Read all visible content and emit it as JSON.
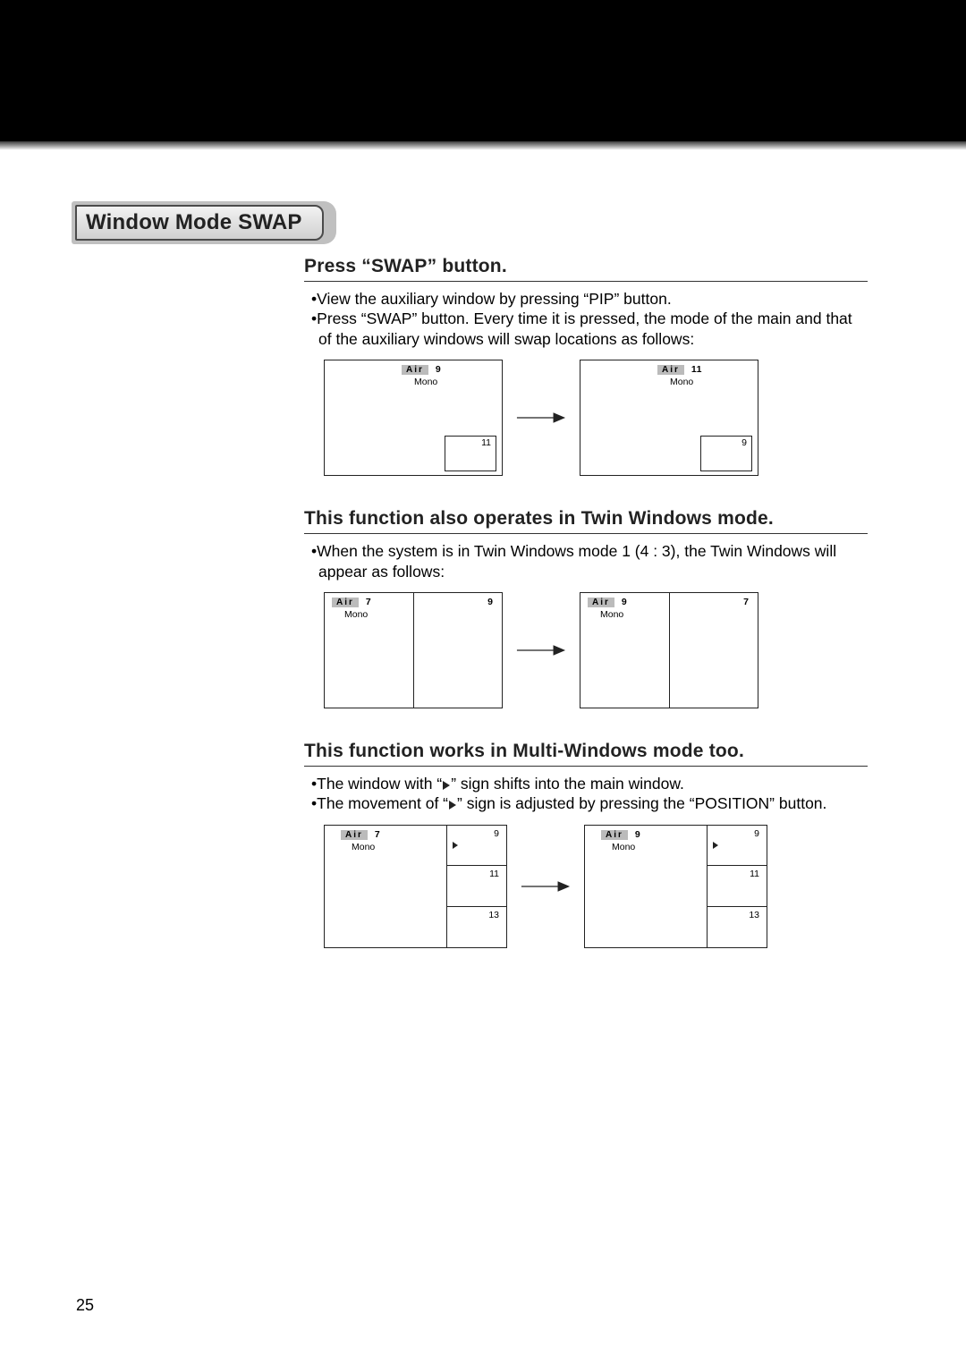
{
  "title": "Window Mode SWAP",
  "page_number": "25",
  "section1": {
    "heading": "Press “SWAP” button.",
    "bullets": [
      "View the auxiliary window by pressing “PIP” button.",
      "Press “SWAP” button. Every time it is pressed, the mode of the main and that of the auxiliary windows will swap locations as follows:"
    ],
    "left": {
      "air_label": "Air",
      "air_num": "9",
      "mono": "Mono",
      "pip_num": "11"
    },
    "right": {
      "air_label": "Air",
      "air_num": "11",
      "mono": "Mono",
      "pip_num": "9"
    }
  },
  "section2": {
    "heading": "This function also operates in Twin Windows mode.",
    "bullets": [
      "When the system is in Twin Windows mode 1 (4 : 3), the Twin Windows will appear as follows:"
    ],
    "left": {
      "air_label": "Air",
      "air_num": "7",
      "mono": "Mono",
      "right_num": "9"
    },
    "right": {
      "air_label": "Air",
      "air_num": "9",
      "mono": "Mono",
      "right_num": "7"
    }
  },
  "section3": {
    "heading": "This function works in Multi-Windows mode too.",
    "bullet1_pre": "The window with “",
    "bullet1_post": "” sign shifts into the main window.",
    "bullet2_pre": "The movement of “",
    "bullet2_post": "” sign is adjusted by pressing the “POSITION” button.",
    "left": {
      "air_label": "Air",
      "air_num": "7",
      "mono": "Mono",
      "cells": [
        "9",
        "11",
        "13"
      ]
    },
    "right": {
      "air_label": "Air",
      "air_num": "9",
      "mono": "Mono",
      "cells": [
        "9",
        "11",
        "13"
      ]
    }
  }
}
